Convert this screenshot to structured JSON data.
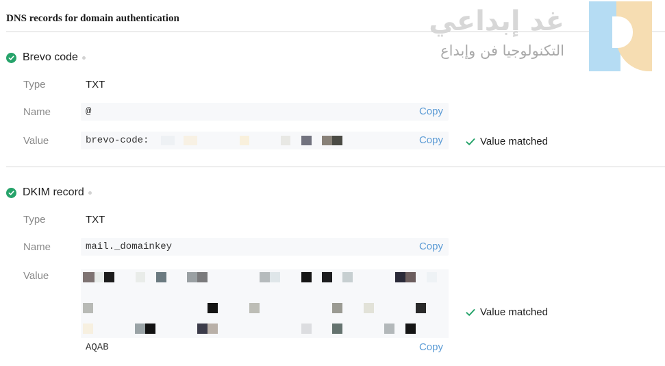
{
  "page": {
    "title": "DNS records for domain authentication"
  },
  "watermark": {
    "title": "غد إبداعي",
    "subtitle": "التكنولوجيا فن وإبداع"
  },
  "colors": {
    "success": "#26a36a",
    "link": "#5b9bd5",
    "label": "#8a8a8a"
  },
  "brevo": {
    "title": "Brevo code",
    "type_label": "Type",
    "type_value": "TXT",
    "name_label": "Name",
    "name_value": "@",
    "name_copy": "Copy",
    "value_label": "Value",
    "value_value": "brevo-code:",
    "value_copy": "Copy",
    "status": "Value matched"
  },
  "dkim": {
    "title": "DKIM record",
    "type_label": "Type",
    "type_value": "TXT",
    "name_label": "Name",
    "name_value": "mail._domainkey",
    "name_copy": "Copy",
    "value_label": "Value",
    "value_tail": "AQAB",
    "value_copy": "Copy",
    "status": "Value matched"
  }
}
